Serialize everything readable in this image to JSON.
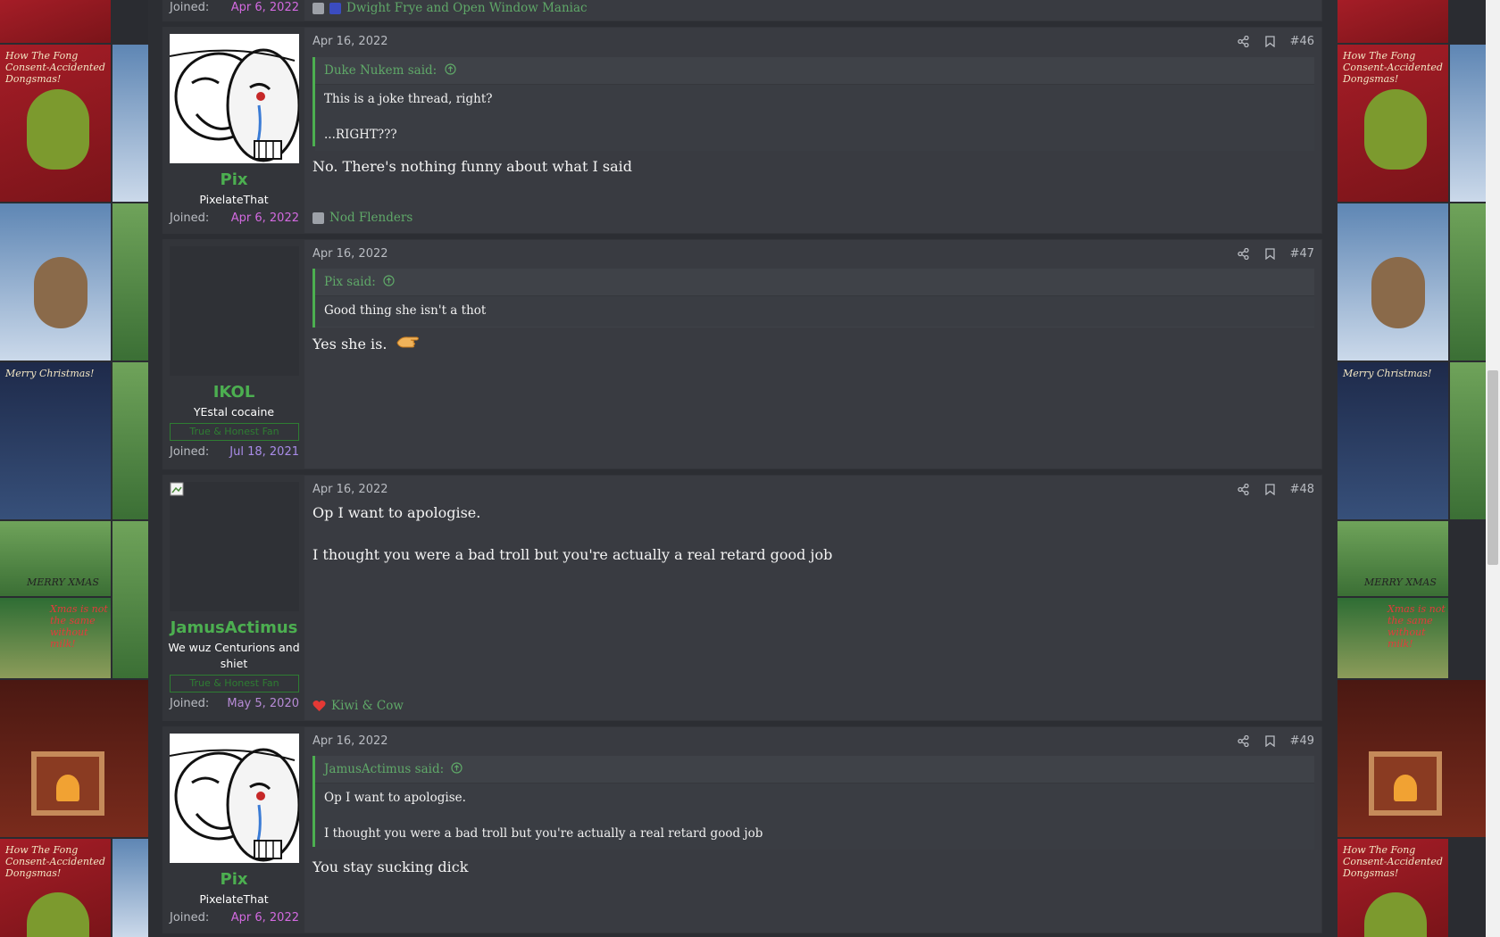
{
  "prev_post_footer": {
    "joined_label": "Joined:",
    "joined_date": "Apr 6, 2022",
    "reaction_text": "Dwight Frye and Open Window Maniac"
  },
  "posts": [
    {
      "number": "#46",
      "date": "Apr 16, 2022",
      "username": "Pix",
      "user_title": "PixelateThat",
      "joined_label": "Joined:",
      "joined_date": "Apr 6, 2022",
      "quote": {
        "author": "Duke Nukem said:",
        "lines": [
          "This is a joke thread, right?",
          "...RIGHT???"
        ]
      },
      "message": [
        "No. There's nothing funny about what I said"
      ],
      "reactions": "Nod Flenders"
    },
    {
      "number": "#47",
      "date": "Apr 16, 2022",
      "username": "IKOL",
      "user_title": "YEstal cocaine",
      "banner": "True & Honest Fan",
      "joined_label": "Joined:",
      "joined_date": "Jul 18, 2021",
      "quote": {
        "author": "Pix said:",
        "lines": [
          "Good thing she isn't a thot"
        ]
      },
      "message": [
        "Yes she is."
      ],
      "emoji": "hand-icon"
    },
    {
      "number": "#48",
      "date": "Apr 16, 2022",
      "username": "JamusActimus",
      "user_title": "We wuz Centurions and shiet",
      "banner": "True & Honest Fan",
      "joined_label": "Joined:",
      "joined_date": "May 5, 2020",
      "message": [
        "Op I want to apologise.",
        "I thought you were a bad troll but you're actually a real retard good job"
      ],
      "reactions": "Kiwi & Cow"
    },
    {
      "number": "#49",
      "date": "Apr 16, 2022",
      "username": "Pix",
      "user_title": "PixelateThat",
      "joined_label": "Joined:",
      "joined_date": "Apr 6, 2022",
      "quote": {
        "author": "JamusActimus said:",
        "lines": [
          "Op I want to apologise.",
          "I thought you were a bad troll but you're actually a real retard good job"
        ]
      },
      "message": [
        "You stay sucking dick"
      ]
    }
  ],
  "background_tiles": {
    "grinch_caption": "How The Fong Consent-Accidented Dongsmas!",
    "xmas_caption": "Merry Christmas!",
    "merry_caption": "MERRY XMAS",
    "milk_caption": "Xmas is not the same without milk!"
  },
  "colors": {
    "accent_green": "#4caf50",
    "joined_pink": "#d36ae0",
    "post_bg": "#393b41"
  }
}
